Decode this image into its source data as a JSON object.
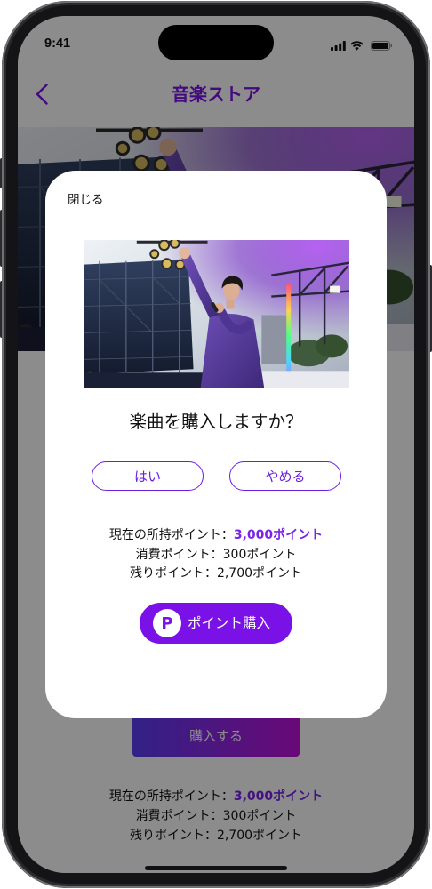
{
  "status_bar": {
    "time": "9:41",
    "icons": [
      "signal-icon",
      "wifi-icon",
      "battery-icon"
    ]
  },
  "header": {
    "back_icon": "chevron-left-icon",
    "title": "音楽ストア"
  },
  "background_page": {
    "purchase_button_label": "購入する",
    "points": {
      "current_label": "現在の所持ポイント：",
      "current_value": "3,000ポイント",
      "spent": "消費ポイント：300ポイント",
      "remaining": "残りポイント：2,700ポイント"
    }
  },
  "modal": {
    "close_label": "閉じる",
    "question": "楽曲を購入しますか？",
    "yes_label": "はい",
    "cancel_label": "やめる",
    "points": {
      "current_label": "現在の所持ポイント：",
      "current_value": "3,000ポイント",
      "spent": "消費ポイント：300ポイント",
      "remaining": "残りポイント：2,700ポイント"
    },
    "buy_points_button": {
      "icon": "point-coin-icon",
      "icon_letter": "P",
      "label": "ポイント購入"
    }
  },
  "colors": {
    "accent": "#7a12e8",
    "accent_text": "#6a1fe0",
    "points_highlight": "#7a22ea",
    "backdrop": "rgba(0,0,0,0.45)",
    "purchase_gradient_start": "#5a3ef5",
    "purchase_gradient_end": "#c010d8"
  }
}
